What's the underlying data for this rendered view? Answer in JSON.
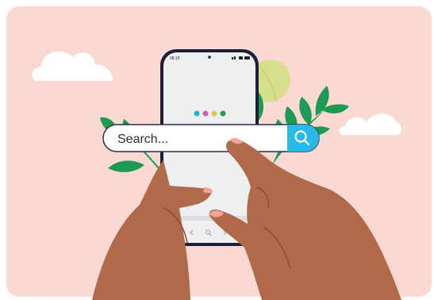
{
  "search": {
    "placeholder": "Search..."
  },
  "phone": {
    "status_time": "08:15",
    "loading_dots": [
      "#19b8d4",
      "#d65aa8",
      "#d9c84c",
      "#1fa14f"
    ]
  },
  "colors": {
    "background": "#fbd9d3",
    "skin": "#b06a4a",
    "leaf_green": "#1f9a55",
    "leaf_yellow": "#d7df8c",
    "search_accent": "#2ab8e8"
  },
  "icons": [
    "search-icon",
    "cloud-icon",
    "leaf-icon",
    "phone-icon",
    "hand-icon",
    "nav-back-icon",
    "nav-search-icon",
    "nav-forward-icon",
    "nav-tab-icon"
  ]
}
